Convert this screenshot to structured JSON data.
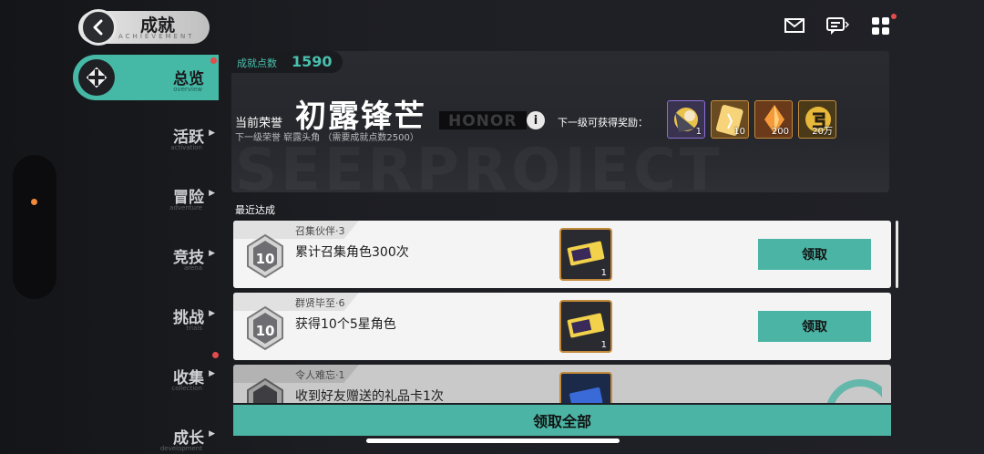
{
  "header": {
    "title": "成就",
    "subtitle": "ACHIEVEMENT"
  },
  "nav": {
    "items": [
      {
        "label": "总览",
        "sub": "overview",
        "active": true,
        "badge": true
      },
      {
        "label": "活跃",
        "sub": "activation",
        "active": false,
        "badge": false
      },
      {
        "label": "冒险",
        "sub": "adventure",
        "active": false,
        "badge": false
      },
      {
        "label": "竞技",
        "sub": "arena",
        "active": false,
        "badge": false
      },
      {
        "label": "挑战",
        "sub": "trials",
        "active": false,
        "badge": false
      },
      {
        "label": "收集",
        "sub": "collection",
        "active": false,
        "badge": true
      },
      {
        "label": "成长",
        "sub": "development",
        "active": false,
        "badge": false
      }
    ]
  },
  "top_icons": [
    {
      "name": "mail-icon"
    },
    {
      "name": "chat-icon"
    },
    {
      "name": "menu-grid-icon",
      "badge": true
    }
  ],
  "honor": {
    "points_label": "成就点数",
    "points_value": "1590",
    "current_label": "当前荣誉",
    "current_title": "初露锋芒",
    "honor_word": "HONOR",
    "watermark": "SEERPROJECT",
    "next_level_text": "下一级荣誉 崭露头角 （需要成就点数2500）",
    "next_reward_label": "下一级可获得奖励：",
    "rewards": [
      {
        "count": "1",
        "icon": "character-avatar-icon"
      },
      {
        "count": "10",
        "icon": "gold-card-icon"
      },
      {
        "count": "200",
        "icon": "crystal-icon"
      },
      {
        "count": "20万",
        "icon": "coin-icon"
      }
    ]
  },
  "recent": {
    "label": "最近达成",
    "items": [
      {
        "tag": "召集伙伴·3",
        "desc": "累计召集角色300次",
        "item_count": "1",
        "button": "领取",
        "medal": "10"
      },
      {
        "tag": "群贤毕至·6",
        "desc": "获得10个5星角色",
        "item_count": "1",
        "button": "领取",
        "medal": "10"
      },
      {
        "tag": "令人难忘·1",
        "desc": "收到好友赠送的礼品卡1次",
        "item_count": "",
        "button": "",
        "medal": ""
      }
    ]
  },
  "claim_all": "领取全部",
  "colors": {
    "accent": "#4bb4a4",
    "badge": "#e24c4c",
    "gold_border": "#c48b3a"
  }
}
